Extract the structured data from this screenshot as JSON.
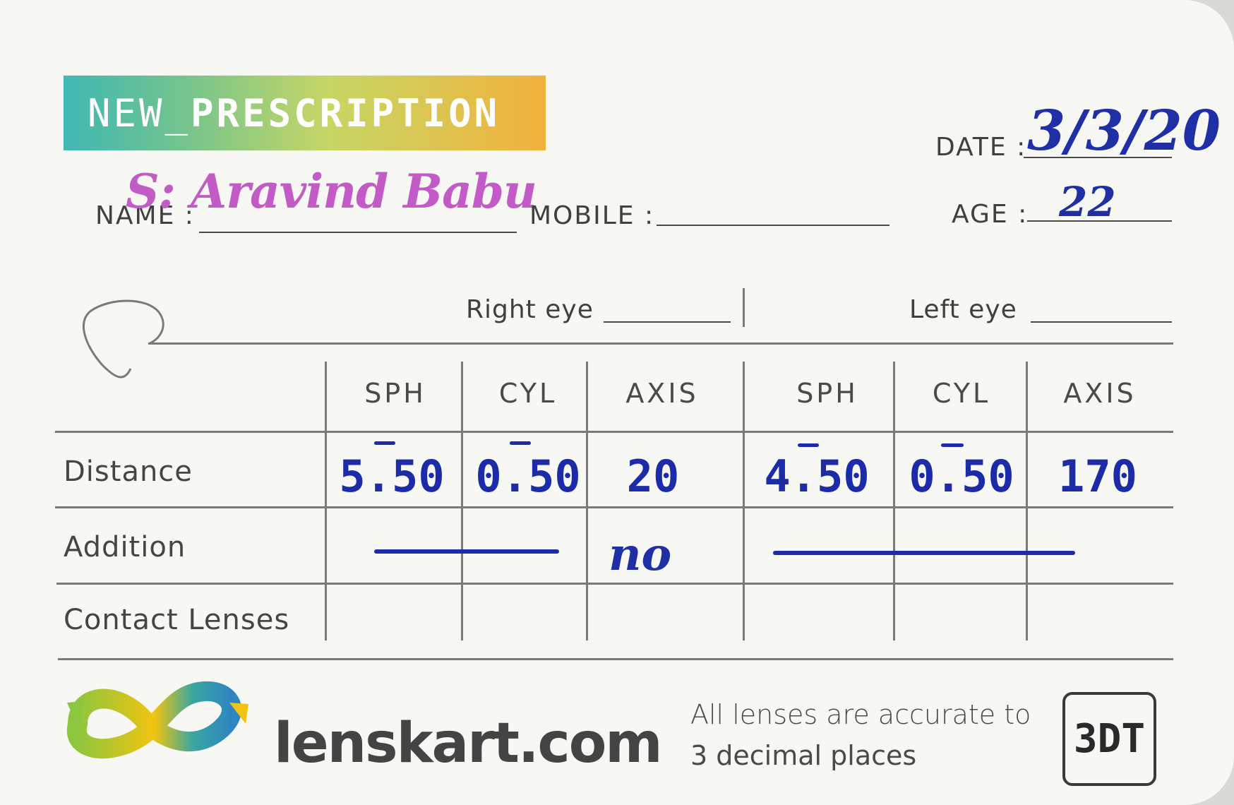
{
  "header": {
    "title_prefix": "NEW_",
    "title_main": "PRESCRIPTION"
  },
  "fields": {
    "name_label": "NAME :",
    "name_value": "S: Aravind Babu",
    "mobile_label": "MOBILE :",
    "date_label": "DATE :",
    "date_value": "3/3/20",
    "age_label": "AGE :",
    "age_value": "22"
  },
  "eyes": {
    "right_label": "Right eye",
    "left_label": "Left eye"
  },
  "table": {
    "columns": [
      "SPH",
      "CYL",
      "AXIS",
      "SPH",
      "CYL",
      "AXIS"
    ],
    "rows": [
      {
        "label": "Distance",
        "values": [
          "5.50",
          "0.50",
          "20",
          "4.50",
          "0.50",
          "170"
        ]
      },
      {
        "label": "Addition",
        "axis_note": "no"
      },
      {
        "label": "Contact Lenses"
      }
    ]
  },
  "footer": {
    "brand": "lenskart.com",
    "disclaimer_line1": "All lenses are accurate to",
    "disclaimer_line2": "3 decimal places",
    "badge": "3DT"
  },
  "colors": {
    "ink_blue": "#1c2ba8",
    "ink_pink": "#c35bc6",
    "banner_start": "#3fb8b4",
    "banner_end": "#f2b23b"
  }
}
